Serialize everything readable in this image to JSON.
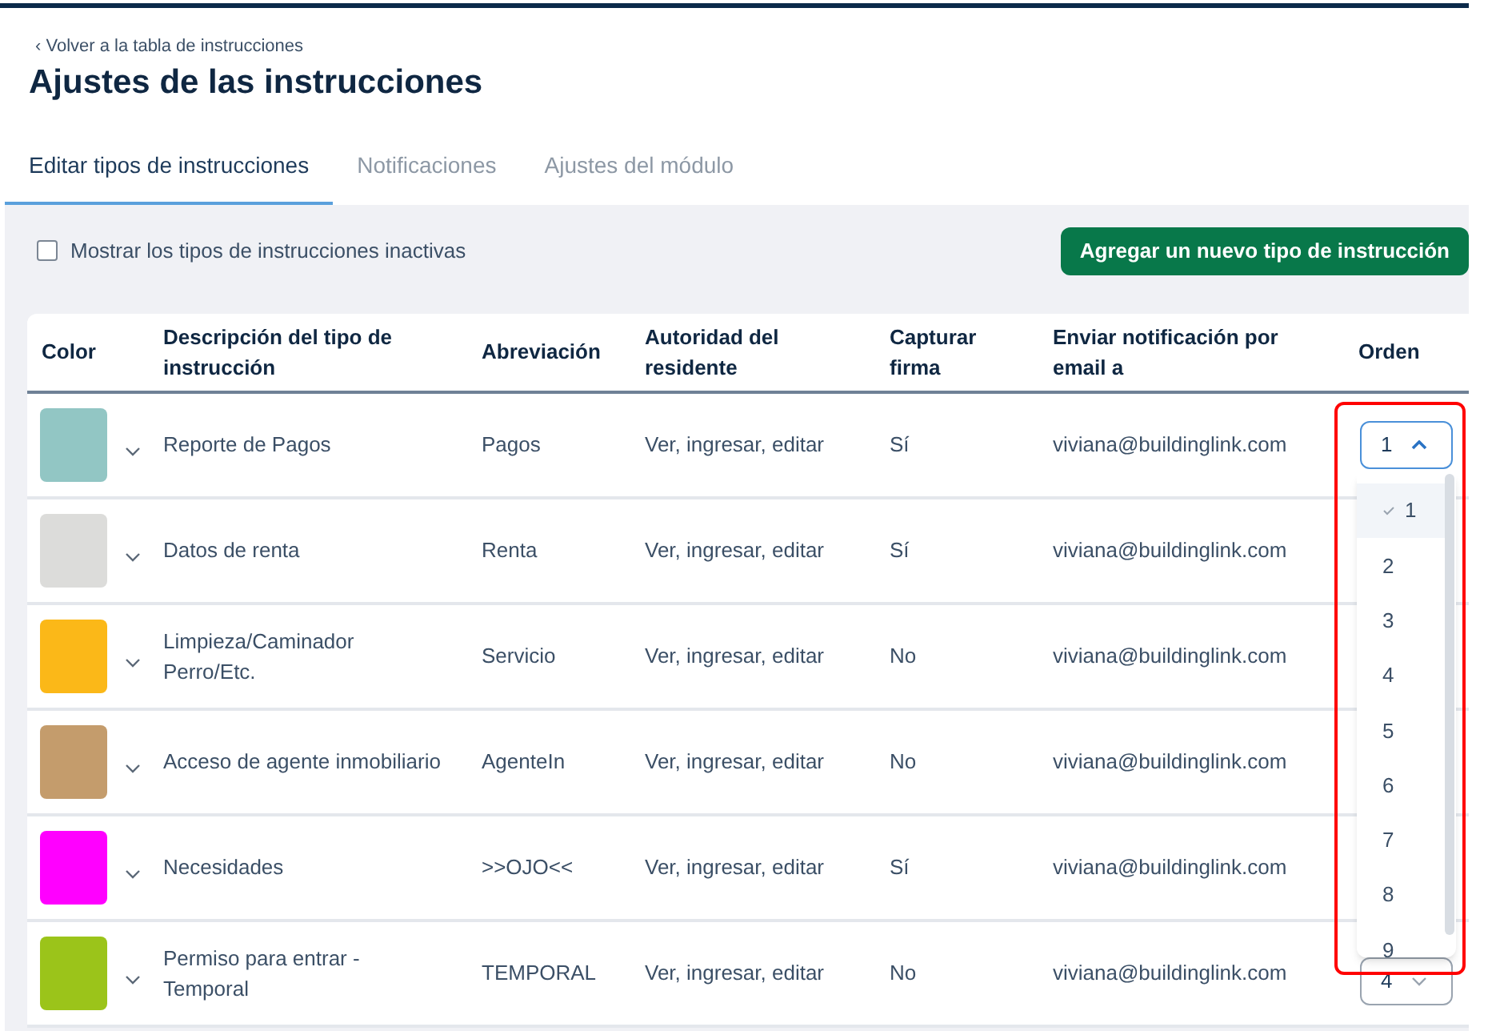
{
  "back_link": "‹ Volver a la tabla de instrucciones",
  "title": "Ajustes de las instrucciones",
  "tabs": [
    {
      "label": "Editar tipos de instrucciones",
      "selected": true
    },
    {
      "label": "Notificaciones",
      "selected": false
    },
    {
      "label": "Ajustes del módulo",
      "selected": false
    }
  ],
  "inactive_toggle": {
    "label": "Mostrar los tipos de instrucciones inactivas",
    "checked": false
  },
  "add_button": "Agregar un nuevo tipo de instrucción",
  "table": {
    "columns": [
      "Color",
      "Descripción del tipo de instrucción",
      "Abreviación",
      "Autoridad del residente",
      "Capturar firma",
      "Enviar notificación por email a",
      "Orden"
    ],
    "rows": [
      {
        "color": "#92c6c4",
        "description": "Reporte de Pagos",
        "abbreviation": "Pagos",
        "authority": "Ver, ingresar, editar",
        "signature": "Sí",
        "email": "viviana@buildinglink.com",
        "order": {
          "value": "1",
          "expanded": true
        }
      },
      {
        "color": "#dcdcda",
        "description": "Datos de renta",
        "abbreviation": "Renta",
        "authority": "Ver, ingresar, editar",
        "signature": "Sí",
        "email": "viviana@buildinglink.com"
      },
      {
        "color": "#fbb818",
        "description": "Limpieza/Caminador Perro/Etc.",
        "abbreviation": "Servicio",
        "authority": "Ver, ingresar, editar",
        "signature": "No",
        "email": "viviana@buildinglink.com"
      },
      {
        "color": "#c49c6c",
        "description": "Acceso de agente inmobiliario",
        "abbreviation": "AgenteIn",
        "authority": "Ver, ingresar, editar",
        "signature": "No",
        "email": "viviana@buildinglink.com"
      },
      {
        "color": "#ff00ff",
        "description": "Necesidades",
        "abbreviation": ">>OJO<<",
        "authority": "Ver, ingresar, editar",
        "signature": "Sí",
        "email": "viviana@buildinglink.com"
      },
      {
        "color": "#9bc41a",
        "description": "Permiso para entrar - Temporal",
        "abbreviation": "TEMPORAL",
        "authority": "Ver, ingresar, editar",
        "signature": "No",
        "email": "viviana@buildinglink.com",
        "order": {
          "value": "4",
          "expanded": false
        }
      }
    ]
  },
  "order_dropdown": {
    "options": [
      {
        "label": "1",
        "selected": true
      },
      {
        "label": "2",
        "selected": false
      },
      {
        "label": "3",
        "selected": false
      },
      {
        "label": "4",
        "selected": false
      },
      {
        "label": "5",
        "selected": false
      },
      {
        "label": "6",
        "selected": false
      },
      {
        "label": "7",
        "selected": false
      },
      {
        "label": "8",
        "selected": false
      },
      {
        "label": "9",
        "selected": false
      }
    ]
  }
}
